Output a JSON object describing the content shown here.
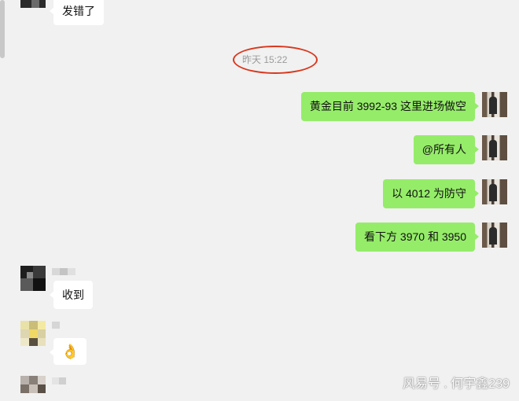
{
  "chat": {
    "top_partial_message": "发错了",
    "timestamp": "昨天 15:22",
    "outgoing": [
      "黄金目前 3992-93 这里进场做空",
      "@所有人",
      "以 4012 为防守",
      "看下方 3970 和 3950"
    ],
    "incoming": [
      "收到",
      "👌"
    ]
  },
  "watermark": "风易号 . 何宇鑫239",
  "colors": {
    "outgoing_bubble": "#95ec69",
    "incoming_bubble": "#ffffff",
    "background": "#f1f1f1",
    "highlight_circle": "#d9381e"
  }
}
